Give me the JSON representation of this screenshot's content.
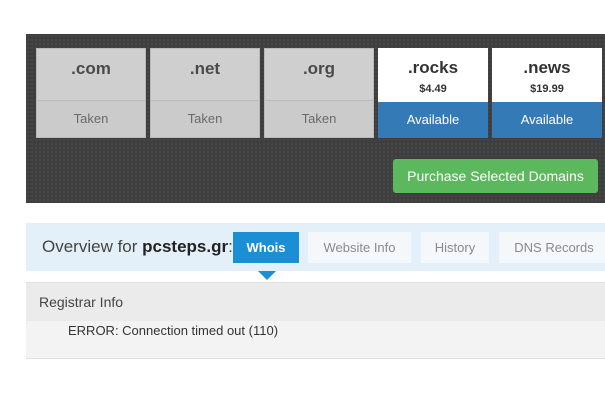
{
  "domains": [
    {
      "tld": ".com",
      "status": "Taken",
      "price": ""
    },
    {
      "tld": ".net",
      "status": "Taken",
      "price": ""
    },
    {
      "tld": ".org",
      "status": "Taken",
      "price": ""
    },
    {
      "tld": ".rocks",
      "status": "Available",
      "price": "$4.49"
    },
    {
      "tld": ".news",
      "status": "Available",
      "price": "$19.99"
    }
  ],
  "purchase_button": "Purchase Selected Domains",
  "overview": {
    "prefix": "Overview for ",
    "domain": "pcsteps.gr",
    "suffix": ":"
  },
  "tabs": [
    {
      "label": "Whois",
      "active": true
    },
    {
      "label": "Website Info",
      "active": false
    },
    {
      "label": "History",
      "active": false
    },
    {
      "label": "DNS Records",
      "active": false
    }
  ],
  "whois": {
    "title": "Registrar Info",
    "error": "ERROR: Connection timed out (110)"
  },
  "colors": {
    "available": "#337ab7",
    "purchase": "#5cb85c",
    "active_tab": "#1a8fd6"
  }
}
